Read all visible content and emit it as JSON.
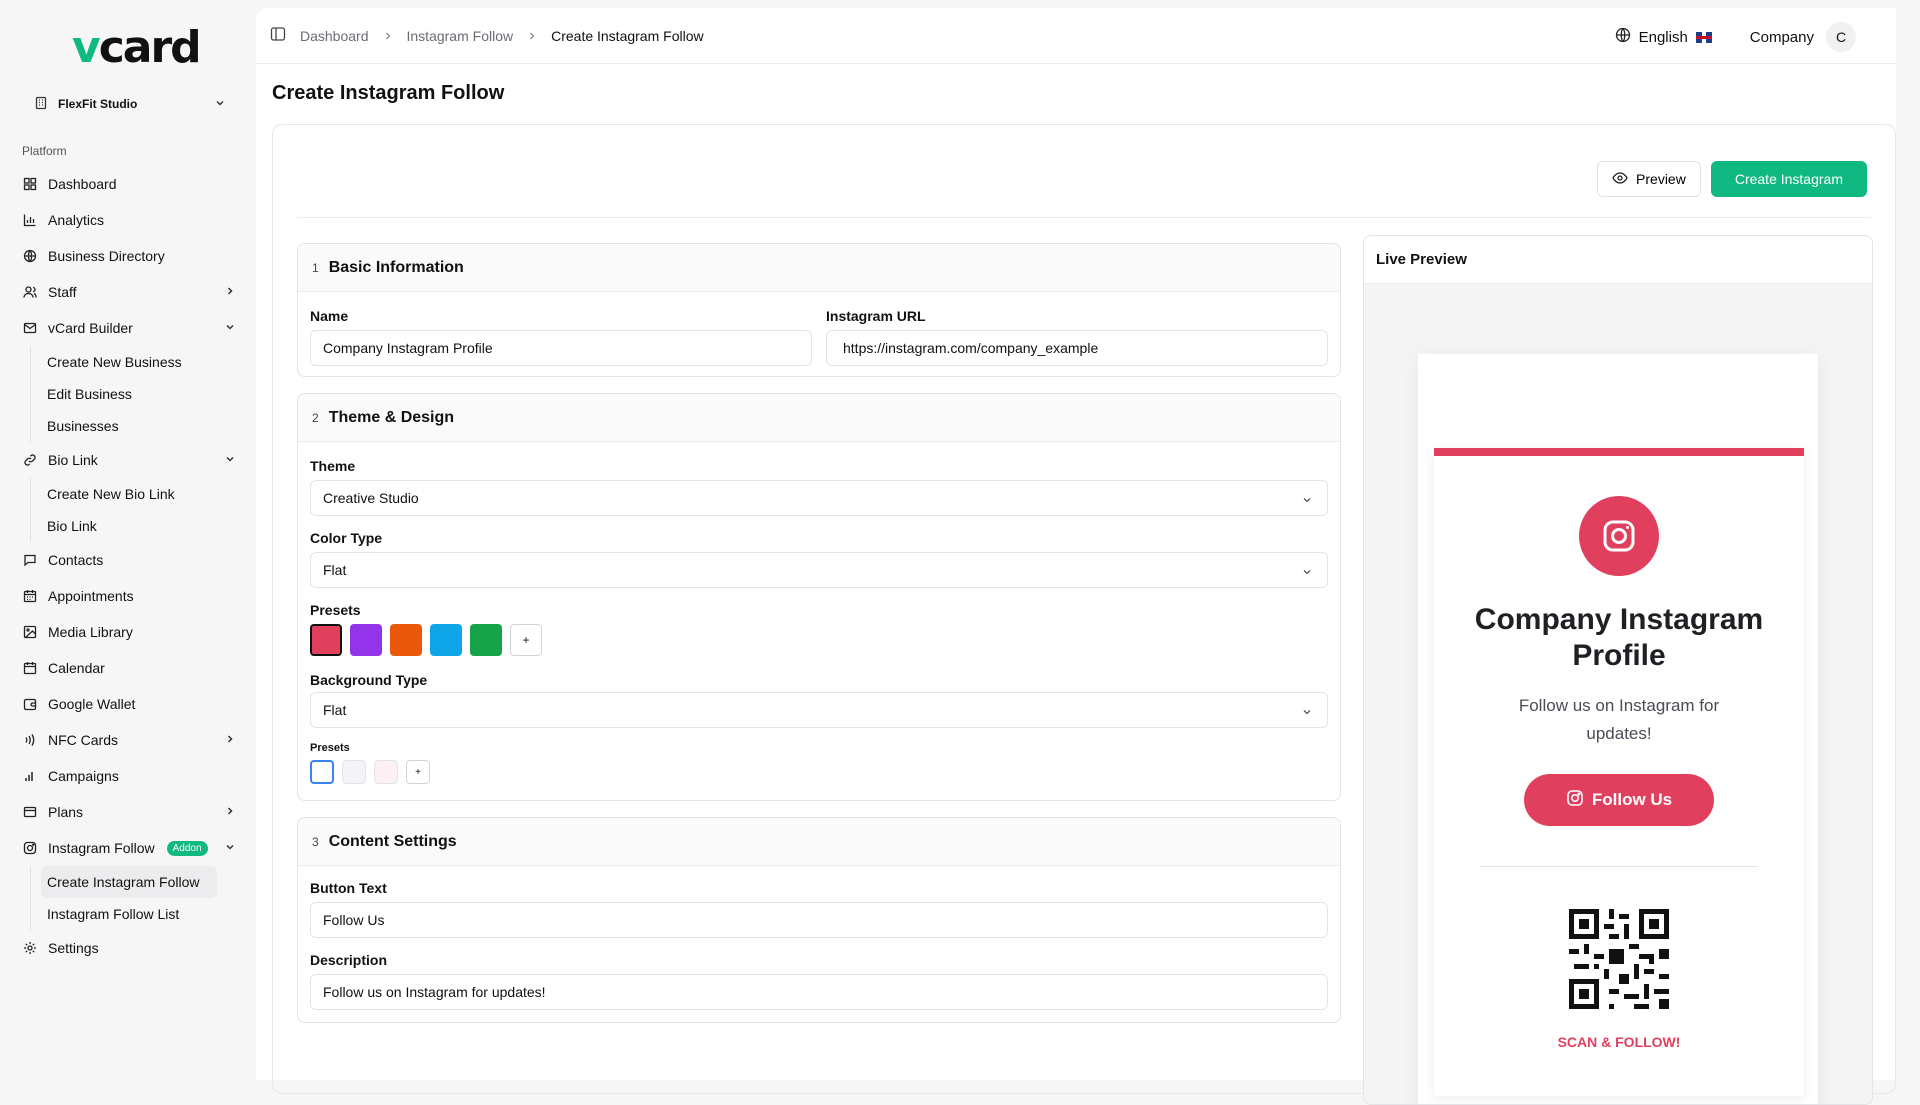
{
  "sidebar": {
    "logo_v": "v",
    "logo_rest": "card",
    "workspace": "FlexFit Studio",
    "section_label": "Platform",
    "items": [
      {
        "label": "Dashboard"
      },
      {
        "label": "Analytics"
      },
      {
        "label": "Business Directory"
      },
      {
        "label": "Staff"
      },
      {
        "label": "vCard Builder"
      },
      {
        "label": "Bio Link"
      },
      {
        "label": "Contacts"
      },
      {
        "label": "Appointments"
      },
      {
        "label": "Media Library"
      },
      {
        "label": "Calendar"
      },
      {
        "label": "Google Wallet"
      },
      {
        "label": "NFC Cards"
      },
      {
        "label": "Campaigns"
      },
      {
        "label": "Plans"
      },
      {
        "label": "Instagram Follow",
        "badge": "Addon"
      },
      {
        "label": "Settings"
      }
    ],
    "vcard_sub": [
      "Create New Business",
      "Edit Business",
      "Businesses"
    ],
    "biolink_sub": [
      "Create New Bio Link",
      "Bio Link"
    ],
    "instagram_sub": [
      "Create Instagram Follow",
      "Instagram Follow List"
    ]
  },
  "header": {
    "breadcrumbs": [
      "Dashboard",
      "Instagram Follow",
      "Create Instagram Follow"
    ],
    "language": "English",
    "company": "Company",
    "avatar_letter": "C"
  },
  "page": {
    "title": "Create Instagram Follow",
    "preview_button": "Preview",
    "create_button": "Create Instagram"
  },
  "sections": {
    "basic": {
      "num": "1",
      "title": "Basic Information",
      "name_label": "Name",
      "name_value": "Company Instagram Profile",
      "url_label": "Instagram URL",
      "url_value": "https://instagram.com/company_example"
    },
    "theme": {
      "num": "2",
      "title": "Theme & Design",
      "theme_label": "Theme",
      "theme_value": "Creative Studio",
      "color_type_label": "Color Type",
      "color_type_value": "Flat",
      "presets_label": "Presets",
      "presets": [
        "#e0405e",
        "#9333ea",
        "#ea580c",
        "#0ea5e9",
        "#16a34a"
      ],
      "add_label": "+",
      "bg_type_label": "Background Type",
      "bg_type_value": "Flat",
      "bg_presets_label": "Presets",
      "bg_presets": [
        "#ffffff",
        "#f3f4f8",
        "#fdf1f5"
      ]
    },
    "content": {
      "num": "3",
      "title": "Content Settings",
      "button_text_label": "Button Text",
      "button_text_value": "Follow Us",
      "description_label": "Description",
      "description_value": "Follow us on Instagram for updates!"
    }
  },
  "preview": {
    "title": "Live Preview",
    "name": "Company Instagram Profile",
    "description": "Follow us on Instagram for updates!",
    "button": "Follow Us",
    "scan_text": "SCAN & FOLLOW!",
    "accent_color": "#e0405e"
  },
  "colors": {
    "brand": "#10b981",
    "accent": "#e0405e"
  }
}
